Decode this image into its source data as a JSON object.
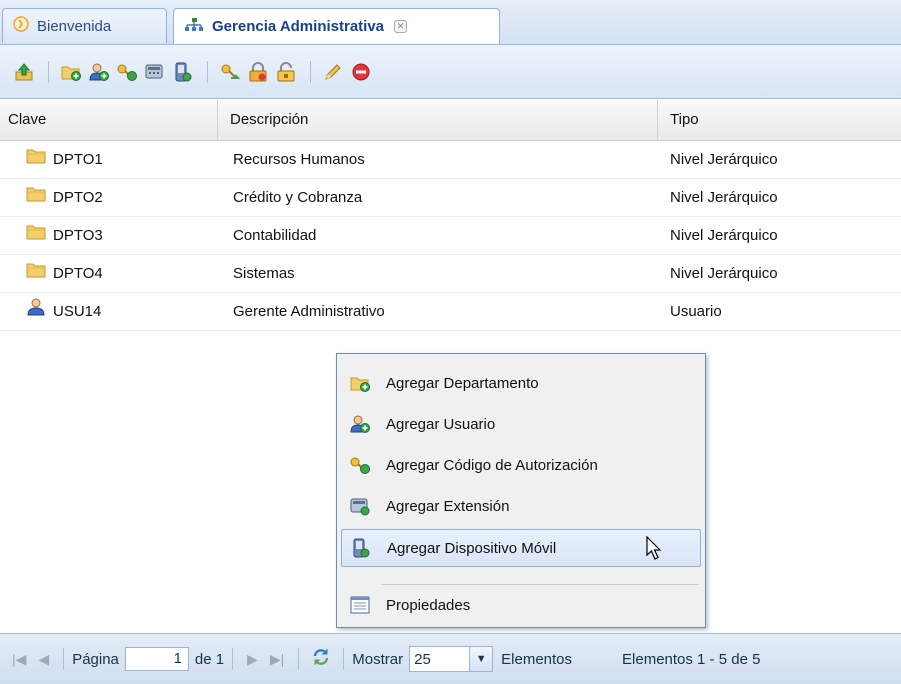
{
  "tabs": [
    {
      "label": "Bienvenida",
      "icon": "welcome-icon"
    },
    {
      "label": "Gerencia Administrativa",
      "icon": "org-chart-icon",
      "active": true
    }
  ],
  "toolbar": {
    "buttons": [
      "upload-icon",
      "add-folder-icon",
      "add-user-icon",
      "add-key-icon",
      "add-extension-icon",
      "add-mobile-icon",
      "move-key-icon",
      "lock-icon",
      "unlock-icon",
      "edit-pencil-icon",
      "delete-icon"
    ]
  },
  "grid": {
    "columns": {
      "clave": "Clave",
      "descripcion": "Descripción",
      "tipo": "Tipo"
    },
    "rows": [
      {
        "clave": "DPTO1",
        "descripcion": "Recursos Humanos",
        "tipo": "Nivel Jerárquico",
        "icon": "folder-icon"
      },
      {
        "clave": "DPTO2",
        "descripcion": "Crédito y Cobranza",
        "tipo": "Nivel Jerárquico",
        "icon": "folder-icon"
      },
      {
        "clave": "DPTO3",
        "descripcion": "Contabilidad",
        "tipo": "Nivel Jerárquico",
        "icon": "folder-icon"
      },
      {
        "clave": "DPTO4",
        "descripcion": "Sistemas",
        "tipo": "Nivel Jerárquico",
        "icon": "folder-icon"
      },
      {
        "clave": "USU14",
        "descripcion": "Gerente Administrativo",
        "tipo": "Usuario",
        "icon": "user-icon"
      }
    ]
  },
  "context_menu": {
    "items": [
      {
        "label": "Agregar Departamento",
        "icon": "add-folder-icon"
      },
      {
        "label": "Agregar Usuario",
        "icon": "add-user-icon"
      },
      {
        "label": "Agregar Código de Autorización",
        "icon": "add-key-icon"
      },
      {
        "label": "Agregar Extensión",
        "icon": "add-extension-icon"
      },
      {
        "label": "Agregar Dispositivo Móvil",
        "icon": "add-mobile-icon",
        "hovered": true
      },
      {
        "label": "Propiedades",
        "icon": "properties-icon"
      }
    ]
  },
  "pager": {
    "page_label": "Página",
    "page_value": "1",
    "of_label": "de 1",
    "show_label": "Mostrar",
    "page_size": "25",
    "items_label": "Elementos",
    "summary": "Elementos 1 - 5 de 5"
  },
  "colors": {
    "accent_border": "#99bbe8",
    "tab_text": "#15428b",
    "folder": "#f2cf6a",
    "delete": "#e0353a"
  }
}
